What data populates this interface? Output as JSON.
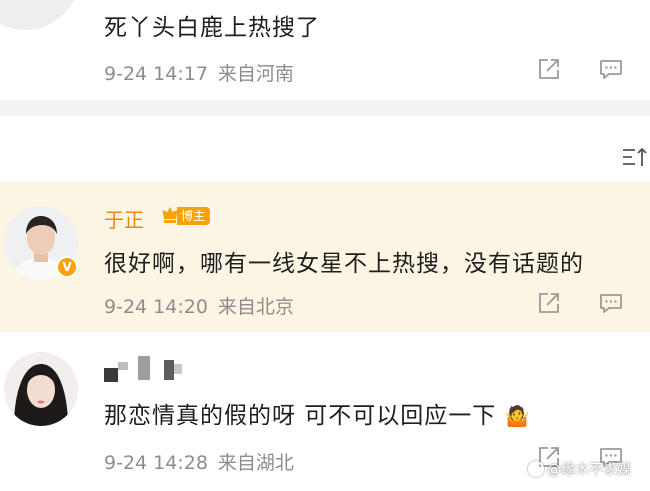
{
  "comments": [
    {
      "text": "死丫头白鹿上热搜了",
      "date": "9-24 14:17",
      "location": "来自河南"
    },
    {
      "username": "于正",
      "badge": "博主",
      "verified_mark": "V",
      "text": "很好啊，哪有一线女星不上热搜，没有话题的",
      "date": "9-24 14:20",
      "location": "来自北京"
    },
    {
      "text": "那恋情真的假的呀 可不可以回应一下",
      "emoji": "🤷",
      "date": "9-24 14:28",
      "location": "来自湖北"
    }
  ],
  "watermark": "@缘木不求媒",
  "colors": {
    "highlight_bg": "#fdf5e3",
    "username": "#e58a12",
    "badge": "#f5a20c",
    "meta_text": "#8d8d8d",
    "icon": "#9a9a9a"
  },
  "icons": [
    "share-icon",
    "comment-icon",
    "sort-icon",
    "crown-icon",
    "verified-icon",
    "shrug-emoji"
  ]
}
